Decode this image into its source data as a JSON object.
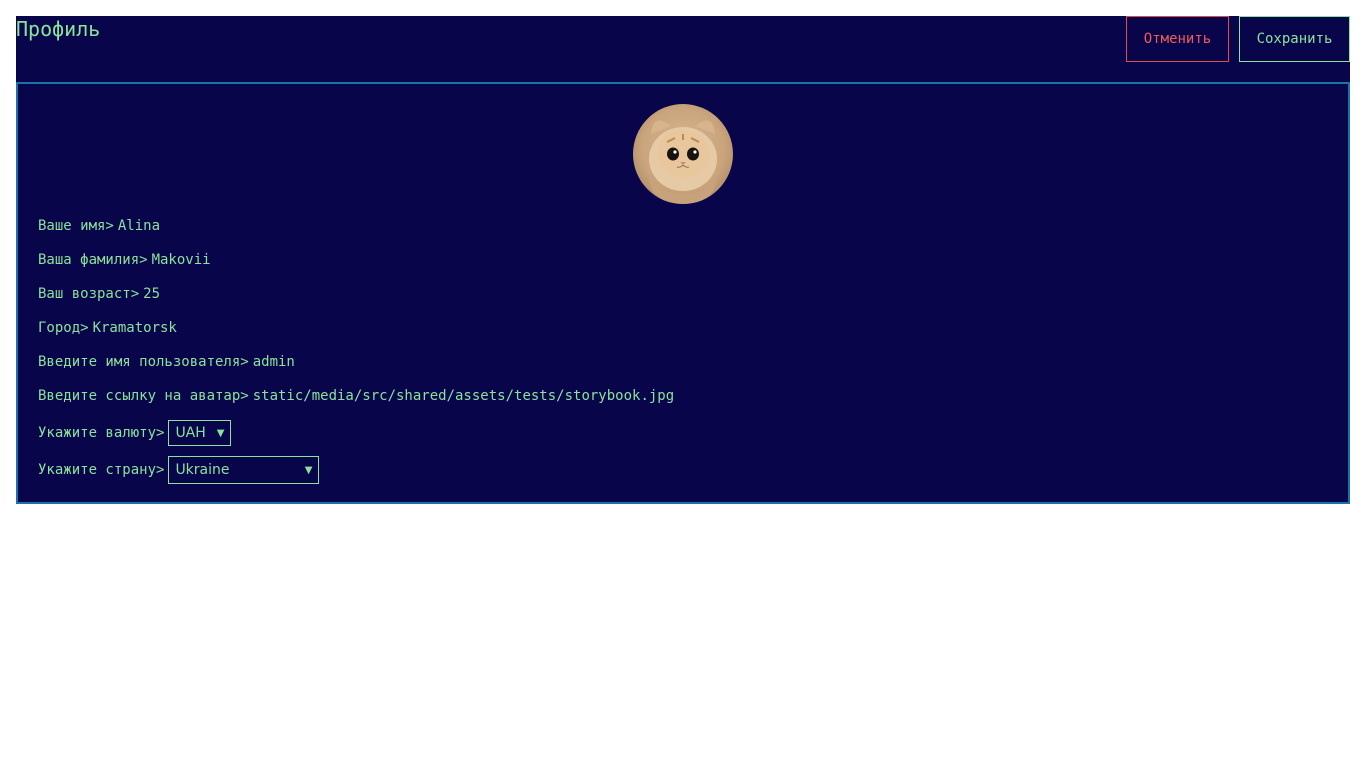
{
  "header": {
    "title": "Профиль",
    "cancel_label": "Отменить",
    "save_label": "Сохранить"
  },
  "colors": {
    "background": "#09054b",
    "text": "#8be29a",
    "cancel": "#f25a5a",
    "border": "#1a73a8"
  },
  "profile": {
    "avatar_icon": "cat-avatar",
    "fields": [
      {
        "label": "Ваше имя>",
        "value": "Alina"
      },
      {
        "label": "Ваша фамилия>",
        "value": "Makovii"
      },
      {
        "label": "Ваш возраст>",
        "value": "25"
      },
      {
        "label": "Город>",
        "value": "Kramatorsk"
      },
      {
        "label": "Введите имя пользователя>",
        "value": "admin"
      },
      {
        "label": "Введите ссылку на аватар>",
        "value": "static/media/src/shared/assets/tests/storybook.jpg"
      }
    ],
    "currency": {
      "label": "Укажите валюту>",
      "selected": "UAH"
    },
    "country": {
      "label": "Укажите страну>",
      "selected": "Ukraine"
    }
  }
}
